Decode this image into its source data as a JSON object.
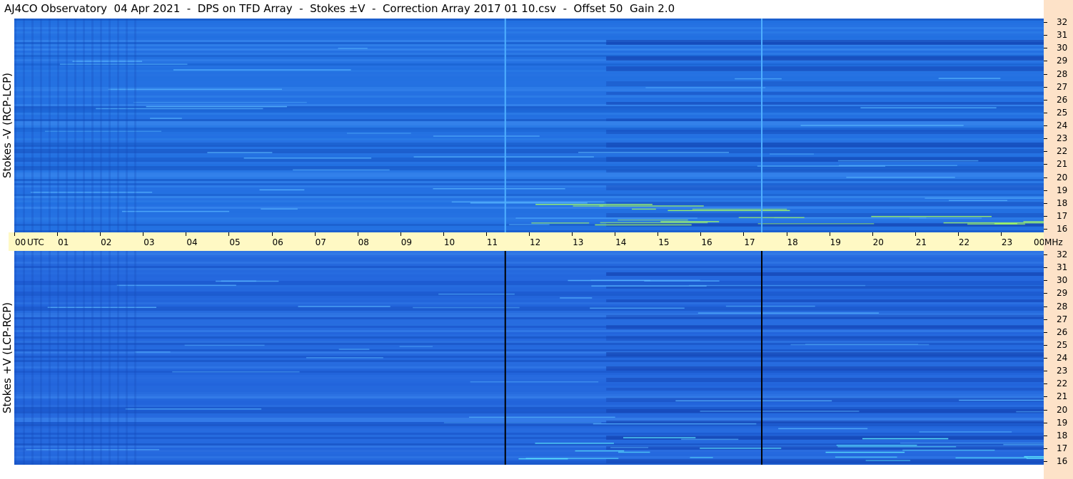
{
  "header": {
    "title": "AJ4CO Observatory  04 Apr 2021  -  DPS on TFD Array  -  Stokes ±V  -  Correction Array 2017 01 10.csv  -  Offset 50  Gain 2.0"
  },
  "chart_data": {
    "type": "heatmap",
    "title": "AJ4CO Observatory  04 Apr 2021  -  DPS on TFD Array  -  Stokes ±V  -  Correction Array 2017 01 10.csv  -  Offset 50  Gain 2.0",
    "x_axis": {
      "unit_label": "UTC",
      "range": [
        0,
        24
      ],
      "tick_labels": [
        "00",
        "01",
        "02",
        "03",
        "04",
        "05",
        "06",
        "07",
        "08",
        "09",
        "10",
        "11",
        "12",
        "13",
        "14",
        "15",
        "16",
        "17",
        "18",
        "19",
        "20",
        "21",
        "22",
        "23",
        "00"
      ],
      "tick_values": [
        0,
        1,
        2,
        3,
        4,
        5,
        6,
        7,
        8,
        9,
        10,
        11,
        12,
        13,
        14,
        15,
        16,
        17,
        18,
        19,
        20,
        21,
        22,
        23,
        24
      ]
    },
    "y_axis": {
      "unit_label": "MHz",
      "range": [
        16,
        32
      ],
      "tick_labels": [
        "32",
        "31",
        "30",
        "29",
        "28",
        "27",
        "26",
        "25",
        "24",
        "23",
        "22",
        "21",
        "20",
        "19",
        "18",
        "17",
        "16"
      ],
      "tick_values": [
        32,
        31,
        30,
        29,
        28,
        27,
        26,
        25,
        24,
        23,
        22,
        21,
        20,
        19,
        18,
        17,
        16
      ]
    },
    "panels": [
      {
        "ylabel": "Stokes -V (RCP-LCP)",
        "marker_times_utc": [
          11.43,
          17.41
        ],
        "marker_color": "#4fb0ff",
        "background_color": "#1f6fe0",
        "intense_color": "#a8ff60"
      },
      {
        "ylabel": "Stokes +V (LCP-RCP)",
        "marker_times_utc": [
          11.43,
          17.41
        ],
        "marker_color": "#000000",
        "background_color": "#1f5fd8",
        "intense_color": "#60f0ff"
      }
    ],
    "grid": false
  },
  "colors": {
    "time_axis_bg": "#fff9c4",
    "freq_axis_bg": "#fde2c8"
  }
}
